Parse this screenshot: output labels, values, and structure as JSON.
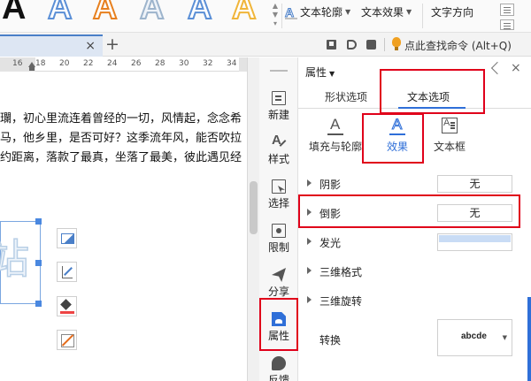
{
  "ribbon": {
    "text_outline": "文本轮廓",
    "text_effect": "文本效果",
    "text_direction": "文字方向",
    "style_sample_glyph": "A"
  },
  "tabbar": {
    "close": "×",
    "new_tab": "+",
    "command_search": "点此查找命令 (Alt+Q)"
  },
  "ruler": {
    "numbers": [
      "16",
      "18",
      "20",
      "22",
      "24",
      "26",
      "28",
      "30",
      "32",
      "34"
    ]
  },
  "document": {
    "lines": [
      "瓓，初心里流连着曾经的一切，风情起，念念希",
      "马，他乡里，是否可好？这季流年风，能否吹拉",
      "约距离，落款了最真，坐落了最美，彼此遇见经"
    ],
    "textbox_text": "站"
  },
  "side_toolbar": {
    "items": [
      "新建",
      "样式",
      "选择",
      "限制",
      "分享",
      "属性",
      "反馈"
    ]
  },
  "panel": {
    "title": "属性",
    "close": "×",
    "tab_shape": "形状选项",
    "tab_text": "文本选项",
    "subtabs": [
      "填充与轮廓",
      "效果",
      "文本框"
    ],
    "rows": [
      {
        "label": "阴影",
        "value": "无"
      },
      {
        "label": "倒影",
        "value": "无"
      },
      {
        "label": "发光",
        "value": ""
      },
      {
        "label": "三维格式",
        "value": ""
      },
      {
        "label": "三维旋转",
        "value": ""
      }
    ],
    "transform_label": "转换",
    "transform_sample": "abcde"
  },
  "colors": {
    "accent": "#2f6fd8",
    "highlight": "#e0001a"
  }
}
